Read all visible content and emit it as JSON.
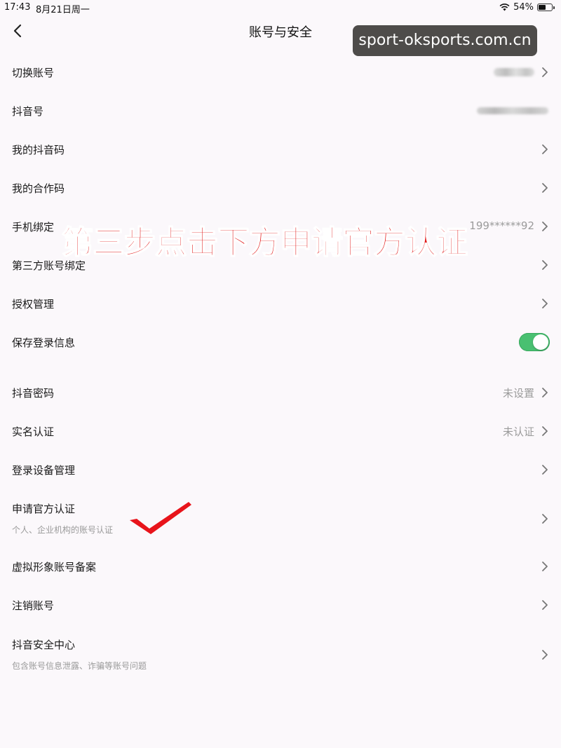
{
  "status_bar": {
    "time": "17:43",
    "date": "8月21日周一",
    "battery_text": "54%",
    "battery_level": 0.54
  },
  "header": {
    "title": "账号与安全",
    "back_icon": "chevron-left-icon"
  },
  "watermark": {
    "text": "sport-oksports.com.cn"
  },
  "overlay": {
    "caption": "第三步点击下方申请官方认证",
    "caption_color": "#e21d1d",
    "checkmark_color": "#e8141b"
  },
  "items": {
    "switch_account": {
      "label": "切换账号"
    },
    "douyin_id": {
      "label": "抖音号"
    },
    "my_code": {
      "label": "我的抖音码"
    },
    "coop_code": {
      "label": "我的合作码"
    },
    "phone_binding": {
      "label": "手机绑定",
      "value": "199******92"
    },
    "third_party": {
      "label": "第三方账号绑定"
    },
    "auth_manage": {
      "label": "授权管理"
    },
    "save_login": {
      "label": "保存登录信息",
      "enabled": true,
      "toggle_color": "#49c071"
    },
    "password": {
      "label": "抖音密码",
      "value": "未设置"
    },
    "real_name": {
      "label": "实名认证",
      "value": "未认证"
    },
    "device_manage": {
      "label": "登录设备管理"
    },
    "official_cert": {
      "label": "申请官方认证",
      "sub": "个人、企业机构的账号认证"
    },
    "virtual_avatar": {
      "label": "虚拟形象账号备案"
    },
    "cancel_account": {
      "label": "注销账号"
    },
    "security_center": {
      "label": "抖音安全中心",
      "sub": "包含账号信息泄露、诈骗等账号问题"
    }
  }
}
